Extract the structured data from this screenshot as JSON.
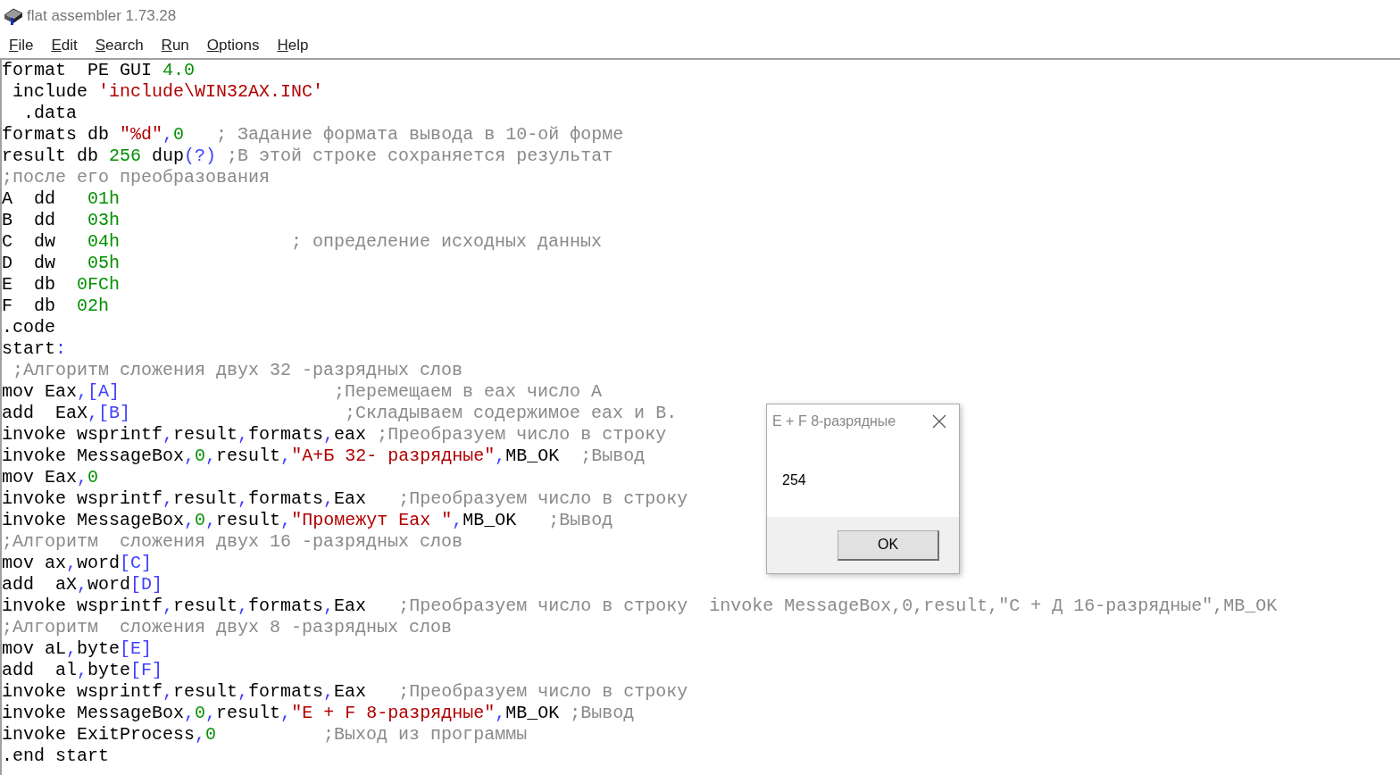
{
  "window": {
    "title": "flat assembler 1.73.28"
  },
  "menu": [
    "File",
    "Edit",
    "Search",
    "Run",
    "Options",
    "Help"
  ],
  "editor": {
    "lines": [
      [
        {
          "kind": "plain",
          "text": "format  PE GUI "
        },
        {
          "kind": "number",
          "text": "4.0"
        }
      ],
      [
        {
          "kind": "plain",
          "text": " include "
        },
        {
          "kind": "string",
          "text": "'include\\WIN32AX.INC'"
        }
      ],
      [
        {
          "kind": "plain",
          "text": "  .data"
        }
      ],
      [
        {
          "kind": "plain",
          "text": "formats db "
        },
        {
          "kind": "string",
          "text": "\"%d\""
        },
        {
          "kind": "symbol",
          "text": ","
        },
        {
          "kind": "number",
          "text": "0"
        },
        {
          "kind": "comment",
          "text": "   ; Задание формата вывода в 10-ой форме"
        }
      ],
      [
        {
          "kind": "plain",
          "text": "result db "
        },
        {
          "kind": "number",
          "text": "256"
        },
        {
          "kind": "plain",
          "text": " dup"
        },
        {
          "kind": "symbol",
          "text": "(?)"
        },
        {
          "kind": "comment",
          "text": " ;В этой строке сохраняется результат"
        }
      ],
      [
        {
          "kind": "comment",
          "text": ";после его преобразования"
        }
      ],
      [
        {
          "kind": "plain",
          "text": "A  dd   "
        },
        {
          "kind": "number",
          "text": "01h"
        }
      ],
      [
        {
          "kind": "plain",
          "text": "B  dd   "
        },
        {
          "kind": "number",
          "text": "03h"
        }
      ],
      [
        {
          "kind": "plain",
          "text": "C  dw   "
        },
        {
          "kind": "number",
          "text": "04h"
        },
        {
          "kind": "comment",
          "text": "                ; определение исходных данных"
        }
      ],
      [
        {
          "kind": "plain",
          "text": "D  dw   "
        },
        {
          "kind": "number",
          "text": "05h"
        }
      ],
      [
        {
          "kind": "plain",
          "text": "E  db  "
        },
        {
          "kind": "number",
          "text": "0FCh"
        }
      ],
      [
        {
          "kind": "plain",
          "text": "F  db  "
        },
        {
          "kind": "number",
          "text": "02h"
        }
      ],
      [
        {
          "kind": "plain",
          "text": ".code"
        }
      ],
      [
        {
          "kind": "plain",
          "text": "start"
        },
        {
          "kind": "symbol",
          "text": ":"
        }
      ],
      [
        {
          "kind": "comment",
          "text": " ;Алгоритм сложения двух 32 -разрядных слов"
        }
      ],
      [
        {
          "kind": "plain",
          "text": "mov Eax"
        },
        {
          "kind": "symbol",
          "text": ",[A]"
        },
        {
          "kind": "comment",
          "text": "                    ;Перемещаем в eax число A"
        }
      ],
      [
        {
          "kind": "plain",
          "text": "add  EaX"
        },
        {
          "kind": "symbol",
          "text": ",[B]"
        },
        {
          "kind": "comment",
          "text": "                    ;Складываем содержимое eax и B."
        }
      ],
      [
        {
          "kind": "plain",
          "text": "invoke wsprintf"
        },
        {
          "kind": "symbol",
          "text": ","
        },
        {
          "kind": "plain",
          "text": "result"
        },
        {
          "kind": "symbol",
          "text": ","
        },
        {
          "kind": "plain",
          "text": "formats"
        },
        {
          "kind": "symbol",
          "text": ","
        },
        {
          "kind": "plain",
          "text": "eax"
        },
        {
          "kind": "comment",
          "text": " ;Преобразуем число в строку"
        }
      ],
      [
        {
          "kind": "plain",
          "text": "invoke MessageBox"
        },
        {
          "kind": "symbol",
          "text": ","
        },
        {
          "kind": "number",
          "text": "0"
        },
        {
          "kind": "symbol",
          "text": ","
        },
        {
          "kind": "plain",
          "text": "result"
        },
        {
          "kind": "symbol",
          "text": ","
        },
        {
          "kind": "string",
          "text": "\"А+Б 32- разрядные\""
        },
        {
          "kind": "symbol",
          "text": ","
        },
        {
          "kind": "plain",
          "text": "MB_OK"
        },
        {
          "kind": "comment",
          "text": "  ;Вывод"
        }
      ],
      [
        {
          "kind": "plain",
          "text": "mov Eax"
        },
        {
          "kind": "symbol",
          "text": ","
        },
        {
          "kind": "number",
          "text": "0"
        }
      ],
      [
        {
          "kind": "plain",
          "text": "invoke wsprintf"
        },
        {
          "kind": "symbol",
          "text": ","
        },
        {
          "kind": "plain",
          "text": "result"
        },
        {
          "kind": "symbol",
          "text": ","
        },
        {
          "kind": "plain",
          "text": "formats"
        },
        {
          "kind": "symbol",
          "text": ","
        },
        {
          "kind": "plain",
          "text": "Eax"
        },
        {
          "kind": "comment",
          "text": "   ;Преобразуем число в строку"
        }
      ],
      [
        {
          "kind": "plain",
          "text": "invoke MessageBox"
        },
        {
          "kind": "symbol",
          "text": ","
        },
        {
          "kind": "number",
          "text": "0"
        },
        {
          "kind": "symbol",
          "text": ","
        },
        {
          "kind": "plain",
          "text": "result"
        },
        {
          "kind": "symbol",
          "text": ","
        },
        {
          "kind": "string",
          "text": "\"Промежут Eax \""
        },
        {
          "kind": "symbol",
          "text": ","
        },
        {
          "kind": "plain",
          "text": "MB_OK"
        },
        {
          "kind": "comment",
          "text": "   ;Вывод"
        }
      ],
      [
        {
          "kind": "comment",
          "text": ";Алгоритм  сложения двух 16 -разрядных слов"
        }
      ],
      [
        {
          "kind": "plain",
          "text": "mov ax"
        },
        {
          "kind": "symbol",
          "text": ","
        },
        {
          "kind": "plain",
          "text": "word"
        },
        {
          "kind": "symbol",
          "text": "[C]"
        }
      ],
      [
        {
          "kind": "plain",
          "text": "add  aX"
        },
        {
          "kind": "symbol",
          "text": ","
        },
        {
          "kind": "plain",
          "text": "word"
        },
        {
          "kind": "symbol",
          "text": "[D]"
        }
      ],
      [
        {
          "kind": "plain",
          "text": "invoke wsprintf"
        },
        {
          "kind": "symbol",
          "text": ","
        },
        {
          "kind": "plain",
          "text": "result"
        },
        {
          "kind": "symbol",
          "text": ","
        },
        {
          "kind": "plain",
          "text": "formats"
        },
        {
          "kind": "symbol",
          "text": ","
        },
        {
          "kind": "plain",
          "text": "Eax"
        },
        {
          "kind": "comment",
          "text": "   ;Преобразуем число в строку  invoke MessageBox,0,result,\"C + Д 16-разрядные\",MB_OK"
        }
      ],
      [
        {
          "kind": "comment",
          "text": ";Алгоритм  сложения двух 8 -разрядных слов"
        }
      ],
      [
        {
          "kind": "plain",
          "text": "mov aL"
        },
        {
          "kind": "symbol",
          "text": ","
        },
        {
          "kind": "plain",
          "text": "byte"
        },
        {
          "kind": "symbol",
          "text": "[E]"
        }
      ],
      [
        {
          "kind": "plain",
          "text": "add  al"
        },
        {
          "kind": "symbol",
          "text": ","
        },
        {
          "kind": "plain",
          "text": "byte"
        },
        {
          "kind": "symbol",
          "text": "[F]"
        }
      ],
      [
        {
          "kind": "plain",
          "text": "invoke wsprintf"
        },
        {
          "kind": "symbol",
          "text": ","
        },
        {
          "kind": "plain",
          "text": "result"
        },
        {
          "kind": "symbol",
          "text": ","
        },
        {
          "kind": "plain",
          "text": "formats"
        },
        {
          "kind": "symbol",
          "text": ","
        },
        {
          "kind": "plain",
          "text": "Eax"
        },
        {
          "kind": "comment",
          "text": "   ;Преобразуем число в строку"
        }
      ],
      [
        {
          "kind": "plain",
          "text": "invoke MessageBox"
        },
        {
          "kind": "symbol",
          "text": ","
        },
        {
          "kind": "number",
          "text": "0"
        },
        {
          "kind": "symbol",
          "text": ","
        },
        {
          "kind": "plain",
          "text": "result"
        },
        {
          "kind": "symbol",
          "text": ","
        },
        {
          "kind": "string",
          "text": "\"E + F 8-разрядные\""
        },
        {
          "kind": "symbol",
          "text": ","
        },
        {
          "kind": "plain",
          "text": "MB_OK"
        },
        {
          "kind": "comment",
          "text": " ;Вывод"
        }
      ],
      [
        {
          "kind": "plain",
          "text": "invoke ExitProcess"
        },
        {
          "kind": "symbol",
          "text": ","
        },
        {
          "kind": "number",
          "text": "0"
        },
        {
          "kind": "comment",
          "text": "          ;Выход из программы"
        }
      ],
      [
        {
          "kind": "plain",
          "text": ".end start"
        }
      ]
    ]
  },
  "dialog": {
    "title": "E + F 8-разрядные",
    "message": "254",
    "button": "OK"
  }
}
